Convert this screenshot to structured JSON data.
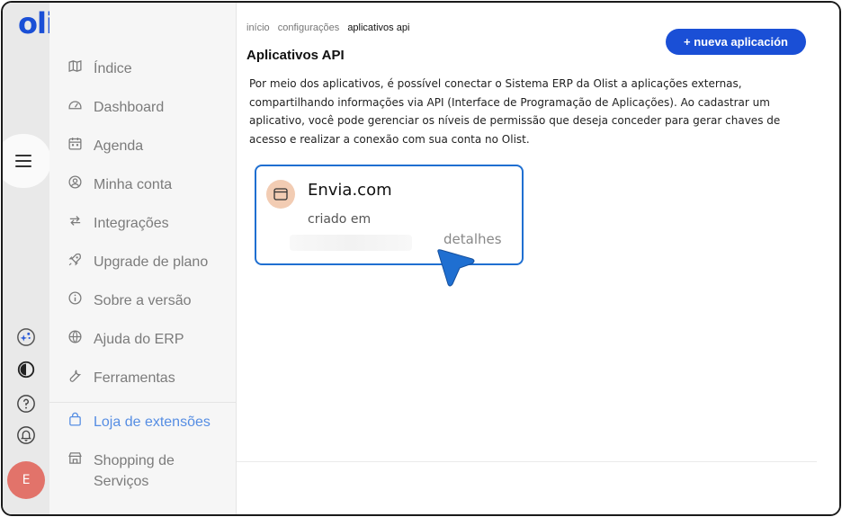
{
  "brand": {
    "logo_text": "olist",
    "color": "#1a4fd6"
  },
  "rail": {
    "menu_icon": "hamburger-icon",
    "icons": [
      "sparkle-icon",
      "contrast-icon",
      "help-icon",
      "bell-icon"
    ],
    "avatar_letter": "E",
    "avatar_color": "#e2736a"
  },
  "sidebar": {
    "items": [
      {
        "label": "Índice",
        "icon": "map-icon"
      },
      {
        "label": "Dashboard",
        "icon": "gauge-icon"
      },
      {
        "label": "Agenda",
        "icon": "calendar-icon"
      },
      {
        "label": "Minha conta",
        "icon": "user-icon"
      },
      {
        "label": "Integrações",
        "icon": "arrows-icon"
      },
      {
        "label": "Upgrade de plano",
        "icon": "rocket-icon"
      },
      {
        "label": "Sobre a versão",
        "icon": "info-icon"
      },
      {
        "label": "Ajuda do ERP",
        "icon": "globe-icon"
      },
      {
        "label": "Ferramentas",
        "icon": "wrench-icon"
      },
      {
        "label": "Loja de extensões",
        "icon": "bag-icon",
        "active": true
      },
      {
        "label": "Shopping de Serviços",
        "icon": "store-icon"
      }
    ],
    "active_color": "#3a7be0"
  },
  "breadcrumb": {
    "items": [
      "início",
      "configurações",
      "aplicativos api"
    ]
  },
  "page": {
    "title": "Aplicativos API",
    "new_button": "+ nueva aplicación",
    "description": "Por meio dos aplicativos, é possível conectar o Sistema ERP da Olist a aplicações externas, compartilhando informações via API (Interface de Programação de Aplicações). Ao cadastrar um aplicativo, você pode gerenciar os níveis de permissão que deseja conceder para gerar chaves de acesso e realizar a conexão com sua conta no Olist."
  },
  "app_card": {
    "name": "Envia.com",
    "created_label": "criado em",
    "details_label": "detalhes",
    "icon": "browser-window-icon",
    "border_color": "#1f6fd1"
  }
}
